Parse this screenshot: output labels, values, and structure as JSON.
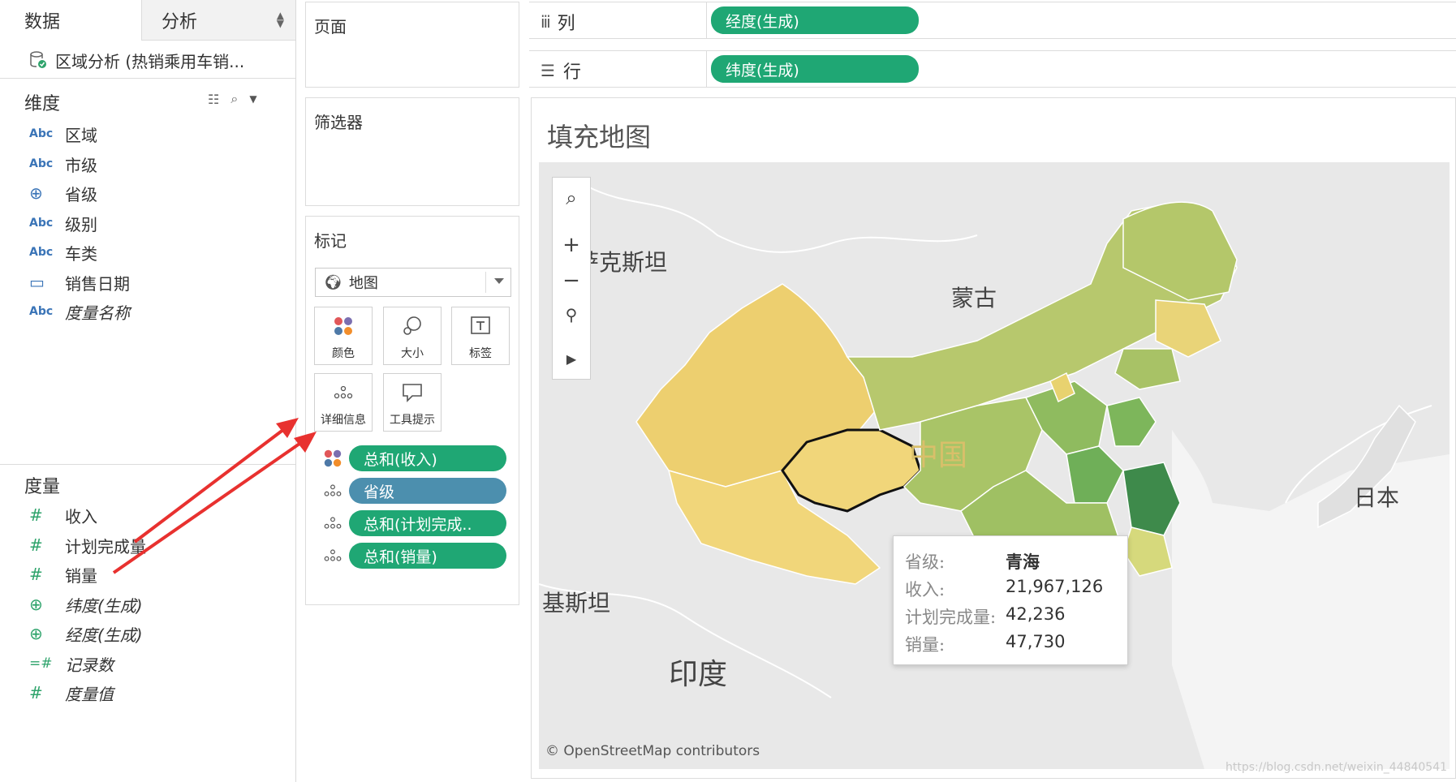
{
  "data_pane": {
    "tab_data": "数据",
    "tab_analysis": "分析",
    "datasource": "区域分析 (热销乘用车销...",
    "dimensions_title": "维度",
    "dimensions": [
      {
        "icon": "Abc",
        "label": "区域"
      },
      {
        "icon": "Abc",
        "label": "市级"
      },
      {
        "icon": "globe",
        "label": "省级"
      },
      {
        "icon": "Abc",
        "label": "级别"
      },
      {
        "icon": "Abc",
        "label": "车类"
      },
      {
        "icon": "calendar",
        "label": "销售日期"
      },
      {
        "icon": "Abc",
        "label": "度量名称"
      }
    ],
    "measures_title": "度量",
    "measures": [
      {
        "icon": "#",
        "label": "收入"
      },
      {
        "icon": "#",
        "label": "计划完成量"
      },
      {
        "icon": "#",
        "label": "销量"
      },
      {
        "icon": "globe",
        "label": "纬度(生成)"
      },
      {
        "icon": "globe",
        "label": "经度(生成)"
      },
      {
        "icon": "=#",
        "label": "记录数"
      },
      {
        "icon": "#",
        "label": "度量值"
      }
    ]
  },
  "shelves": {
    "pages_title": "页面",
    "filters_title": "筛选器",
    "marks_title": "标记",
    "mark_type": "地图",
    "mark_buttons": [
      "颜色",
      "大小",
      "标签",
      "详细信息",
      "工具提示"
    ],
    "mark_pills": [
      {
        "kind": "color",
        "label": "总和(收入)",
        "color": "#1fa774"
      },
      {
        "kind": "detail",
        "label": "省级",
        "color": "#4c8fae"
      },
      {
        "kind": "detail",
        "label": "总和(计划完成..",
        "color": "#1fa774"
      },
      {
        "kind": "detail",
        "label": "总和(销量)",
        "color": "#1fa774"
      }
    ],
    "columns_label": "列",
    "columns_pill": "经度(生成)",
    "rows_label": "行",
    "rows_pill": "纬度(生成)"
  },
  "view": {
    "title": "填充地图",
    "map_labels": [
      "哈萨克斯坦",
      "蒙古",
      "中国",
      "日本",
      "基斯坦",
      "印度"
    ],
    "attribution": "© OpenStreetMap contributors",
    "tooltip": [
      {
        "key": "省级:",
        "value": "青海"
      },
      {
        "key": "收入:",
        "value": "21,967,126"
      },
      {
        "key": "计划完成量:",
        "value": "42,236"
      },
      {
        "key": "销量:",
        "value": "47,730"
      }
    ],
    "watermark": "https://blog.csdn.net/weixin_44840541"
  },
  "colors": {
    "pill_green": "#1fa774",
    "pill_blue": "#4c8fae",
    "annotation_arrow": "#e8312f"
  }
}
